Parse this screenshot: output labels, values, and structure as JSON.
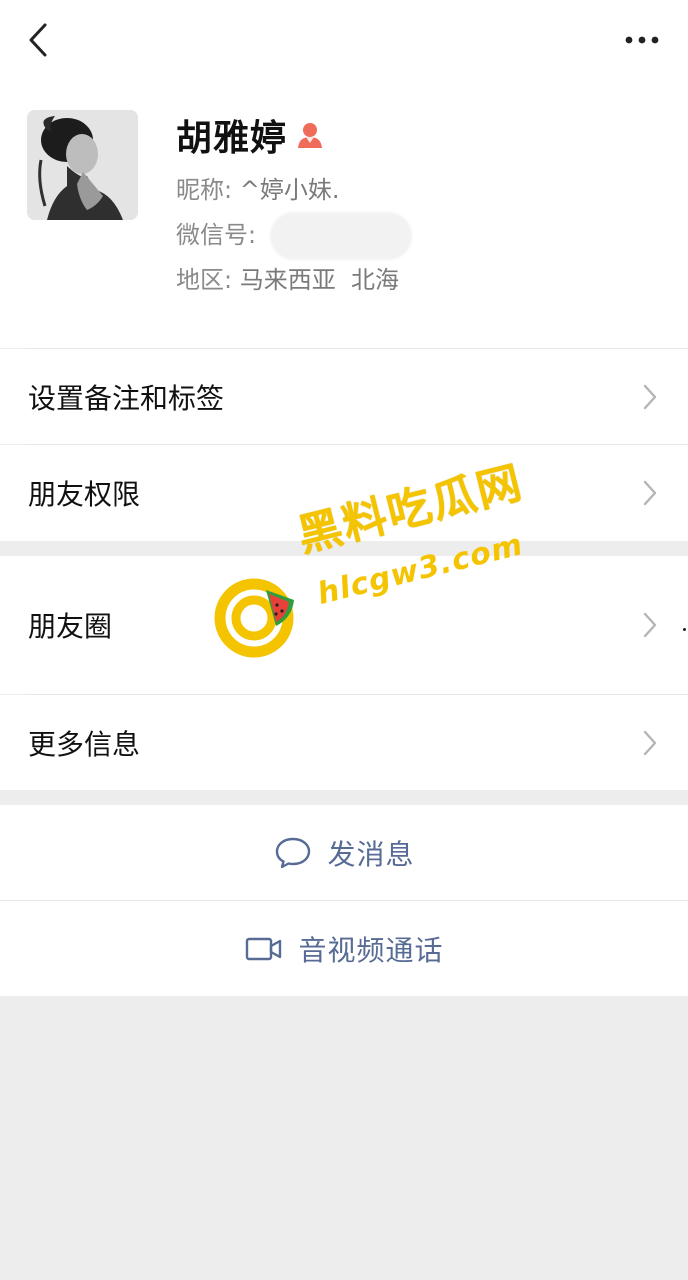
{
  "profile": {
    "name": "胡雅婷",
    "nickname_label": "昵称:",
    "nickname": "^婷小妹.",
    "wechat_id_label": "微信号:",
    "region_label": "地区:",
    "region": "马来西亚  北海",
    "gender_icon": "female-user-icon"
  },
  "menu": {
    "remark_tags": "设置备注和标签",
    "friend_permissions": "朋友权限",
    "moments": "朋友圈",
    "more_info": "更多信息"
  },
  "actions": {
    "send_message": "发消息",
    "video_call": "音视频通话"
  },
  "watermark": {
    "site_cn": "黑料吃瓜网",
    "site_url": "hlcgw3.com"
  },
  "colors": {
    "link_blue": "#576b95",
    "watermark_yellow": "#f5c400",
    "female_icon": "#f06b59",
    "background": "#ededed"
  }
}
